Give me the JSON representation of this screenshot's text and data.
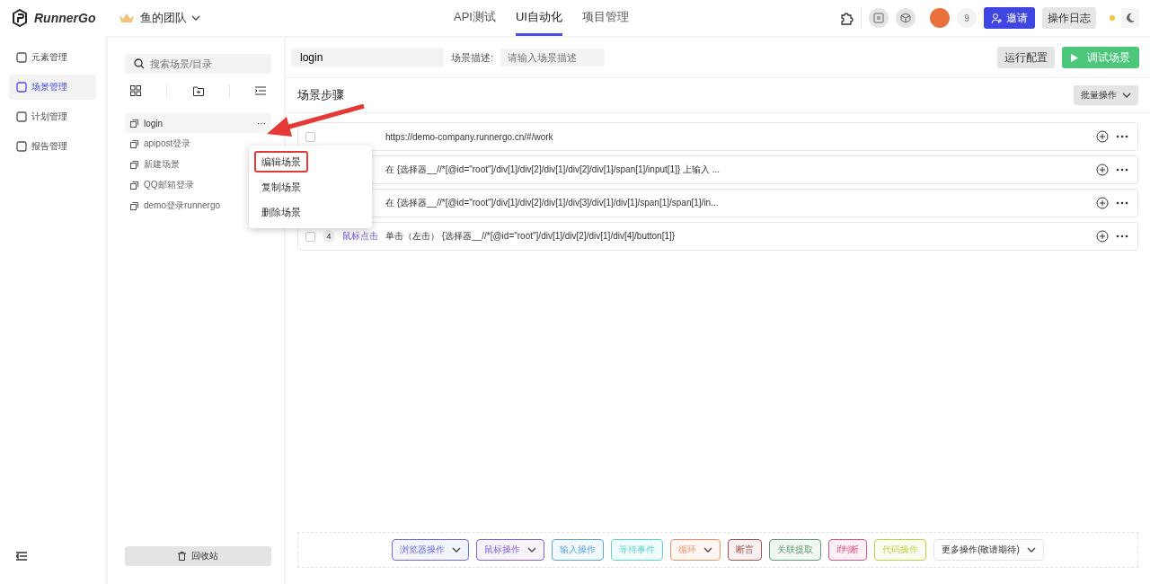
{
  "app": {
    "name": "RunnerGo",
    "team": "鱼的团队"
  },
  "top_tabs": [
    {
      "label": "API测试",
      "selected": false
    },
    {
      "label": "UI自动化",
      "selected": true
    },
    {
      "label": "项目管理",
      "selected": false
    }
  ],
  "header": {
    "member_count": "9",
    "invite": "邀请",
    "log": "操作日志",
    "dark_mode": false
  },
  "sidebar": {
    "items": [
      {
        "label": "元素管理",
        "selected": false
      },
      {
        "label": "场景管理",
        "selected": true
      },
      {
        "label": "计划管理",
        "selected": false
      },
      {
        "label": "报告管理",
        "selected": false
      }
    ]
  },
  "scenes": {
    "search_placeholder": "搜索场景/目录",
    "items": [
      {
        "name": "login",
        "selected": true
      },
      {
        "name": "apipost登录",
        "selected": false
      },
      {
        "name": "新建场景",
        "selected": false
      },
      {
        "name": "QQ邮箱登录",
        "selected": false
      },
      {
        "name": "demo登录runnergo",
        "selected": false
      }
    ],
    "more": "···",
    "recycle": "回收站"
  },
  "context_menu": {
    "items": [
      {
        "label": "编辑场景",
        "highlighted": true
      },
      {
        "label": "复制场景",
        "highlighted": false
      },
      {
        "label": "删除场景",
        "highlighted": false
      }
    ]
  },
  "scene": {
    "name": "login",
    "desc_label": "场景描述:",
    "desc_placeholder": "请输入场景描述",
    "run_config": "运行配置",
    "debug": "调试场景",
    "steps_title": "场景步骤",
    "batch": "批量操作"
  },
  "steps": [
    {
      "checked": false,
      "text": "https://demo-company.runnergo.cn/#/work"
    },
    {
      "text": "在 {选择器__//*[@id=\"root\"]/div[1]/div[2]/div[1]/div[2]/div[1]/span[1]/input[1]} 上输入 ..."
    },
    {
      "text": "在 {选择器__//*[@id=\"root\"]/div[1]/div[2]/div[1]/div[3]/div[1]/div[1]/span[1]/span[1]/in..."
    },
    {
      "checked": false,
      "number": "4",
      "type": "鼠标点击",
      "text": "单击（左击） {选择器__//*[@id=\"root\"]/div[1]/div[2]/div[1]/div[4]/button[1]}"
    }
  ],
  "action_bar": [
    {
      "label": "浏览器操作",
      "color": "#6b6fd6",
      "dropdown": true
    },
    {
      "label": "鼠标操作",
      "color": "#8a63d2",
      "dropdown": true
    },
    {
      "label": "输入操作",
      "color": "#5aa6d6",
      "dropdown": false
    },
    {
      "label": "等待事件",
      "color": "#5fd3cf",
      "dropdown": false
    },
    {
      "label": "循环",
      "color": "#e8956a",
      "dropdown": true
    },
    {
      "label": "断言",
      "color": "#a0524f",
      "dropdown": false
    },
    {
      "label": "关联提取",
      "color": "#5f9f6f",
      "dropdown": false
    },
    {
      "label": "if判断",
      "color": "#d9558c",
      "dropdown": false
    },
    {
      "label": "代码操作",
      "color": "#c4cf4a",
      "dropdown": false
    },
    {
      "label": "更多操作(敬请期待)",
      "color": "#e4e4e4",
      "dropdown": true
    }
  ]
}
